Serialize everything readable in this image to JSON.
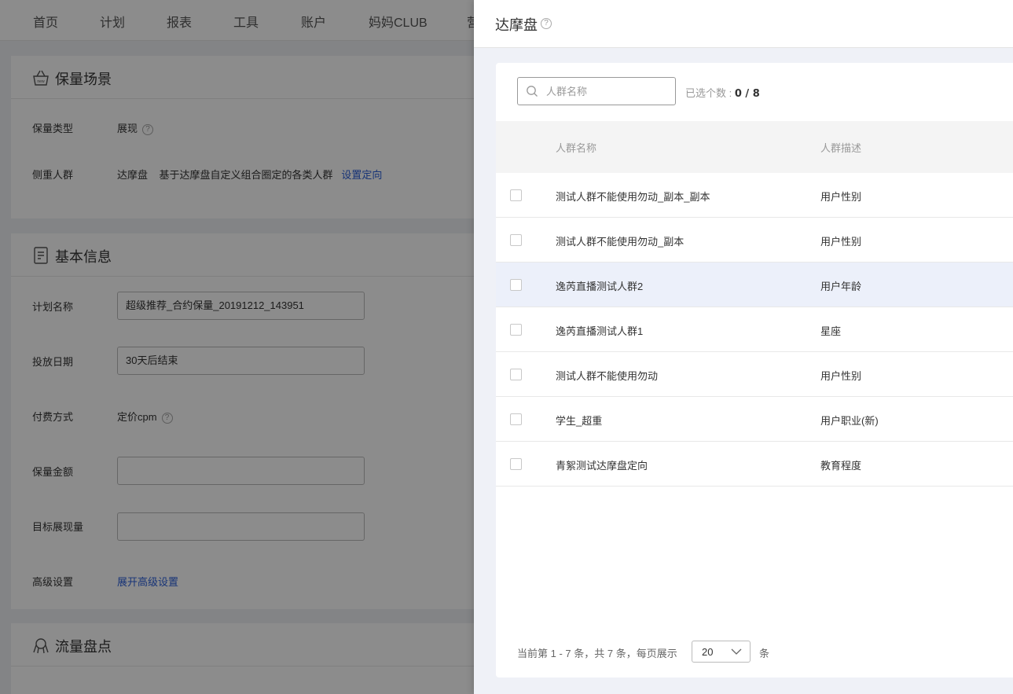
{
  "topnav": {
    "items": [
      "首页",
      "计划",
      "报表",
      "工具",
      "账户",
      "妈妈CLUB",
      "营"
    ]
  },
  "cards": {
    "scene": {
      "title": "保量场景",
      "type_label": "保量类型",
      "type_value": "展现",
      "crowd_label": "侧重人群",
      "crowd_value": "达摩盘",
      "crowd_desc": "基于达摩盘自定义组合圈定的各类人群",
      "crowd_link": "设置定向"
    },
    "basic": {
      "title": "基本信息",
      "plan_name_label": "计划名称",
      "plan_name_value": "超级推荐_合约保量_20191212_143951",
      "date_label": "投放日期",
      "date_value": "30天后结束",
      "pay_label": "付费方式",
      "pay_value": "定价cpm",
      "amount_label": "保量金额",
      "amount_value": "",
      "target_label": "目标展现量",
      "target_value": "",
      "advanced_label": "高级设置",
      "advanced_link": "展开高级设置"
    },
    "traffic": {
      "title": "流量盘点"
    }
  },
  "drawer": {
    "title": "达摩盘",
    "help": "?",
    "search_placeholder": "人群名称",
    "selected_label": "已选个数 : ",
    "selected_value": "0 / 8",
    "columns": [
      "人群名称",
      "人群描述"
    ],
    "rows": [
      {
        "name": "测试人群不能使用勿动_副本_副本",
        "desc": "用户性别"
      },
      {
        "name": "测试人群不能使用勿动_副本",
        "desc": "用户性别"
      },
      {
        "name": "逸芮直播测试人群2",
        "desc": "用户年龄"
      },
      {
        "name": "逸芮直播测试人群1",
        "desc": "星座"
      },
      {
        "name": "测试人群不能使用勿动",
        "desc": "用户性别"
      },
      {
        "name": "学生_超重",
        "desc": "用户职业(新)"
      },
      {
        "name": "青絮测试达摩盘定向",
        "desc": "教育程度"
      }
    ],
    "highlighted_row": 2,
    "pager_text": "当前第 1 - 7 条，共 7 条，每页展示",
    "page_size": "20",
    "page_unit": "条"
  },
  "colors": {
    "link": "#2b5fd9",
    "row_highlight": "#ecf0fa",
    "overlay": "rgba(0,0,0,0.45)"
  }
}
